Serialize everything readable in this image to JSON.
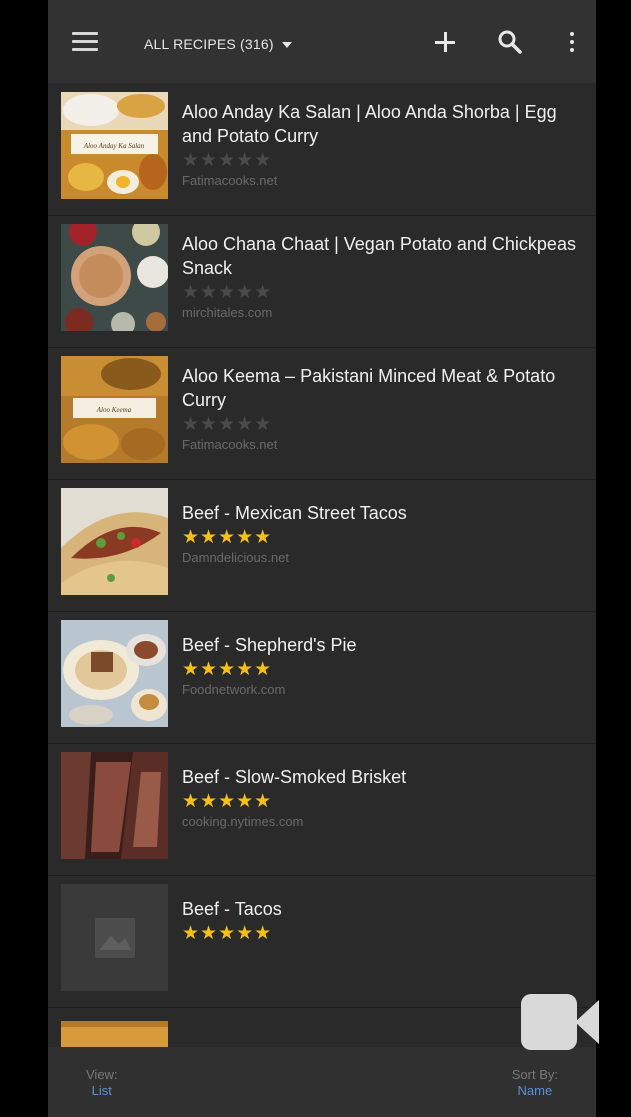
{
  "header": {
    "title": "ALL RECIPES (316)",
    "menu_icon": "hamburger-menu-icon",
    "add_icon": "plus-icon",
    "search_icon": "search-icon",
    "overflow_icon": "more-vert-icon"
  },
  "recipes": [
    {
      "name": "Aloo Anday Ka Salan | Aloo Anda Shorba | Egg and Potato Curry",
      "rating": 0,
      "stars": "★★★★★",
      "source": "Fatimacooks.net",
      "thumb_caption": "Aloo Anday Ka Salan"
    },
    {
      "name": "Aloo Chana Chaat | Vegan Potato and Chickpeas Snack",
      "rating": 0,
      "stars": "★★★★★",
      "source": "mirchitales.com"
    },
    {
      "name": "Aloo Keema – Pakistani Minced Meat & Potato Curry",
      "rating": 0,
      "stars": "★★★★★",
      "source": "Fatimacooks.net",
      "thumb_caption": "Aloo Keema"
    },
    {
      "name": "Beef - Mexican Street Tacos",
      "rating": 5,
      "stars": "★★★★★",
      "source": "Damndelicious.net"
    },
    {
      "name": "Beef - Shepherd's Pie",
      "rating": 5,
      "stars": "★★★★★",
      "source": "Foodnetwork.com"
    },
    {
      "name": "Beef - Slow-Smoked Brisket",
      "rating": 5,
      "stars": "★★★★★",
      "source": "cooking.nytimes.com"
    },
    {
      "name": "Beef - Tacos",
      "rating": 5,
      "stars": "★★★★★",
      "source": ""
    }
  ],
  "footer": {
    "view_label": "View:",
    "view_value": "List",
    "sort_label": "Sort By:",
    "sort_value": "Name"
  },
  "colors": {
    "background": "#2a2a2a",
    "toolbar": "#323232",
    "star_on": "#f5c116",
    "star_off": "#4a4a4a",
    "link_blue": "#5b8fd6"
  }
}
